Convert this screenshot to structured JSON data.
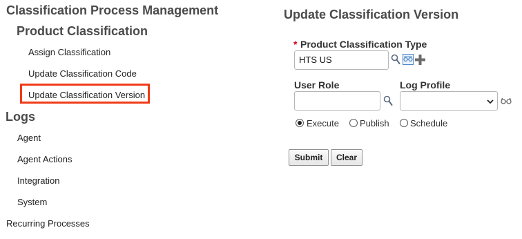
{
  "nav": {
    "section_title": "Classification Process Management",
    "subsection_title": "Product Classification",
    "classification_items": [
      {
        "label": "Assign Classification"
      },
      {
        "label": "Update Classification Code"
      },
      {
        "label": "Update Classification Version",
        "highlighted": true
      }
    ],
    "logs_title": "Logs",
    "logs_items": [
      {
        "label": "Agent"
      },
      {
        "label": "Agent Actions"
      },
      {
        "label": "Integration"
      },
      {
        "label": "System"
      }
    ],
    "recurring_label": "Recurring Processes"
  },
  "form": {
    "title": "Update Classification Version",
    "required_marker": "*",
    "type_label": "Product Classification Type",
    "type_value": "HTS US",
    "user_role_label": "User Role",
    "user_role_value": "",
    "log_profile_label": "Log Profile",
    "log_profile_value": "",
    "run_options": [
      {
        "label": "Execute",
        "selected": true
      },
      {
        "label": "Publish",
        "selected": false
      },
      {
        "label": "Schedule",
        "selected": false
      }
    ],
    "submit_label": "Submit",
    "clear_label": "Clear"
  },
  "colors": {
    "highlight": "#f03a17",
    "required": "#d8001e",
    "icon": "#5b6b80"
  }
}
